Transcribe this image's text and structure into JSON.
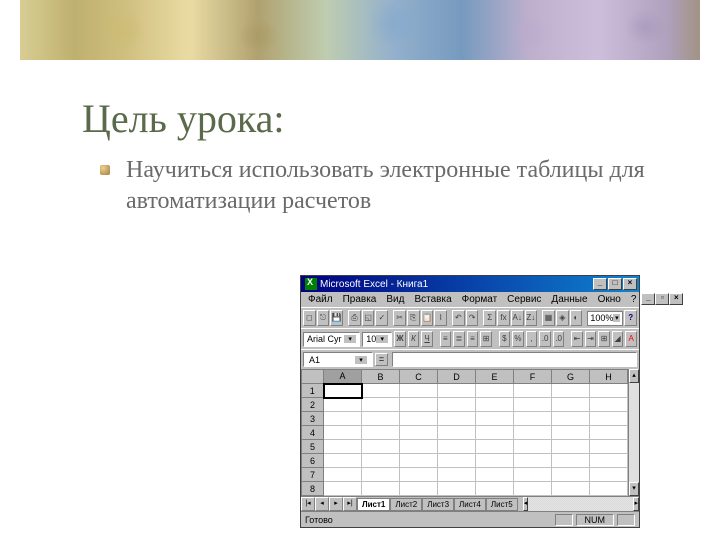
{
  "slide": {
    "title": "Цель урока:",
    "body": "Научиться использовать электронные таблицы для автоматизации расчетов"
  },
  "excel": {
    "titlebar": "Microsoft Excel - Книга1",
    "menu": [
      "Файл",
      "Правка",
      "Вид",
      "Вставка",
      "Формат",
      "Сервис",
      "Данные",
      "Окно",
      "?"
    ],
    "zoom": "100%",
    "font": "Arial Cyr",
    "fontSize": "10",
    "cellRef": "A1",
    "columns": [
      "A",
      "B",
      "C",
      "D",
      "E",
      "F",
      "G",
      "H"
    ],
    "rows": [
      "1",
      "2",
      "3",
      "4",
      "5",
      "6",
      "7",
      "8"
    ],
    "sheets": [
      "Лист1",
      "Лист2",
      "Лист3",
      "Лист4",
      "Лист5"
    ],
    "activeSheet": 0,
    "status": "Готово",
    "statusNum": "NUM"
  }
}
